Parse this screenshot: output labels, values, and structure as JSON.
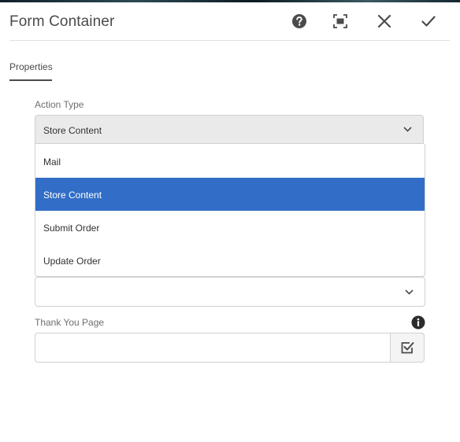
{
  "dialog": {
    "title": "Form Container",
    "header_icons": {
      "help": "help-icon",
      "fullscreen": "fullscreen-icon",
      "close": "close-icon",
      "done": "checkmark-icon"
    }
  },
  "tabs": [
    {
      "label": "Properties",
      "active": true
    }
  ],
  "action_type": {
    "label": "Action Type",
    "selected": "Store Content",
    "options": [
      "Mail",
      "Store Content",
      "Submit Order",
      "Update Order"
    ],
    "highlighted_option": "Store Content"
  },
  "second_select": {
    "value": ""
  },
  "thank_you_page": {
    "label": "Thank You Page",
    "value": "",
    "info_icon": "info-icon",
    "picker_icon": "path-browser-icon"
  },
  "colors": {
    "accent": "#326ec8",
    "text": "#323232",
    "muted": "#6e6e6e",
    "border": "#d0d0d0",
    "select_bg": "#eaeaea"
  }
}
